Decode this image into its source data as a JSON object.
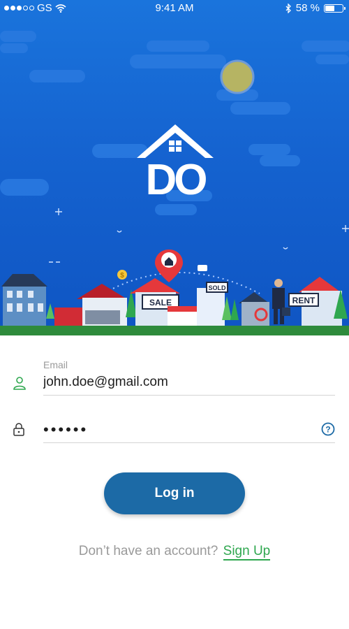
{
  "status_bar": {
    "carrier": "GS",
    "time": "9:41 AM",
    "battery_percent": "58 %",
    "battery_level": 0.58
  },
  "hero": {
    "logo_text": "DO",
    "signs": {
      "sale": "SALE",
      "sold": "SOLD",
      "rent": "RENT"
    },
    "coin_symbol": "$"
  },
  "login": {
    "email_label": "Email",
    "email_value": "john.doe@gmail.com",
    "password_masked": "••••••",
    "help_symbol": "?",
    "login_button": "Log in",
    "signup_prompt": "Don’t have an account?",
    "signup_link": "Sign Up"
  },
  "colors": {
    "sky": "#1563d0",
    "primary_button": "#1c6aa6",
    "accent_green": "#2fa74f",
    "ground": "#2e8b3c"
  },
  "icons": {
    "user": "user-icon",
    "lock": "lock-icon",
    "help": "help-circle-icon",
    "wifi": "wifi-icon",
    "bluetooth": "bluetooth-icon",
    "battery": "battery-icon"
  }
}
